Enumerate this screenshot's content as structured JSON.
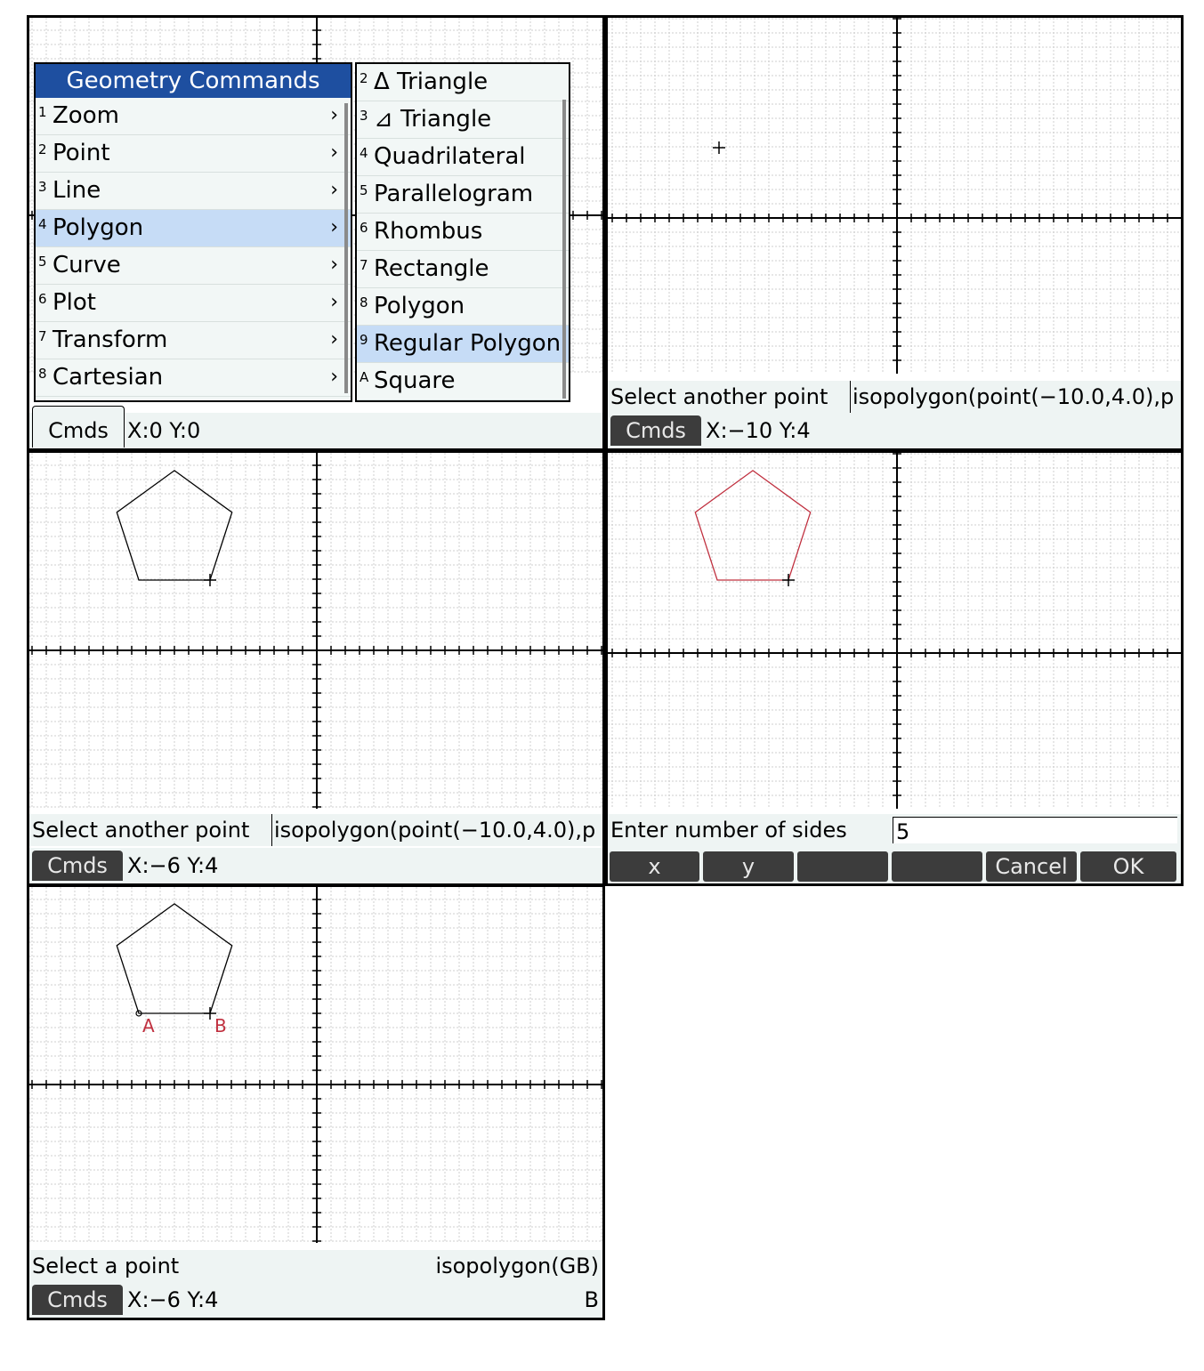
{
  "panel1": {
    "menu_title": "Geometry Commands",
    "menu_items": [
      {
        "num": "1",
        "label": "Zoom",
        "chevron": "›"
      },
      {
        "num": "2",
        "label": "Point",
        "chevron": "›"
      },
      {
        "num": "3",
        "label": "Line",
        "chevron": "›"
      },
      {
        "num": "4",
        "label": "Polygon",
        "chevron": "›"
      },
      {
        "num": "5",
        "label": "Curve",
        "chevron": "›"
      },
      {
        "num": "6",
        "label": "Plot",
        "chevron": "›"
      },
      {
        "num": "7",
        "label": "Transform",
        "chevron": "›"
      },
      {
        "num": "8",
        "label": "Cartesian",
        "chevron": "›"
      }
    ],
    "submenu_items": [
      {
        "num": "2",
        "label": "Δ Triangle"
      },
      {
        "num": "3",
        "label": "⊿ Triangle"
      },
      {
        "num": "4",
        "label": "Quadrilateral"
      },
      {
        "num": "5",
        "label": "Parallelogram"
      },
      {
        "num": "6",
        "label": "Rhombus"
      },
      {
        "num": "7",
        "label": "Rectangle"
      },
      {
        "num": "8",
        "label": "Polygon"
      },
      {
        "num": "9",
        "label": "Regular Polygon"
      },
      {
        "num": "A",
        "label": "Square"
      }
    ],
    "cmds_label": "Cmds",
    "coords": "X:0 Y:0"
  },
  "panel2": {
    "prompt": "Select another point",
    "entry": "isopolygon(point(−10.0,4.0),p",
    "cmds_label": "Cmds",
    "coords": "X:−10 Y:4"
  },
  "panel3": {
    "prompt": "Select another point",
    "entry": "isopolygon(point(−10.0,4.0),p",
    "cmds_label": "Cmds",
    "coords": "X:−6 Y:4"
  },
  "panel4": {
    "prompt": "Enter number of sides",
    "input_value": "5",
    "soft_keys": [
      "x",
      "y",
      "",
      "",
      "Cancel",
      "OK"
    ],
    "polygon_color": "#c0303f"
  },
  "panel5": {
    "prompt": "Select a point",
    "entry": "isopolygon(GB)",
    "cmds_label": "Cmds",
    "coords": "X:−6 Y:4",
    "right_label": "B",
    "point_labels": [
      "A",
      "B"
    ],
    "label_color": "#c0303f"
  },
  "colors": {
    "grid": "#cfcfcf",
    "status_bg": "#eef4f3",
    "menu_title_bg": "#1e4fa0",
    "menu_selected_bg": "#c6dcf6",
    "button_bg": "#3c3c3c"
  }
}
